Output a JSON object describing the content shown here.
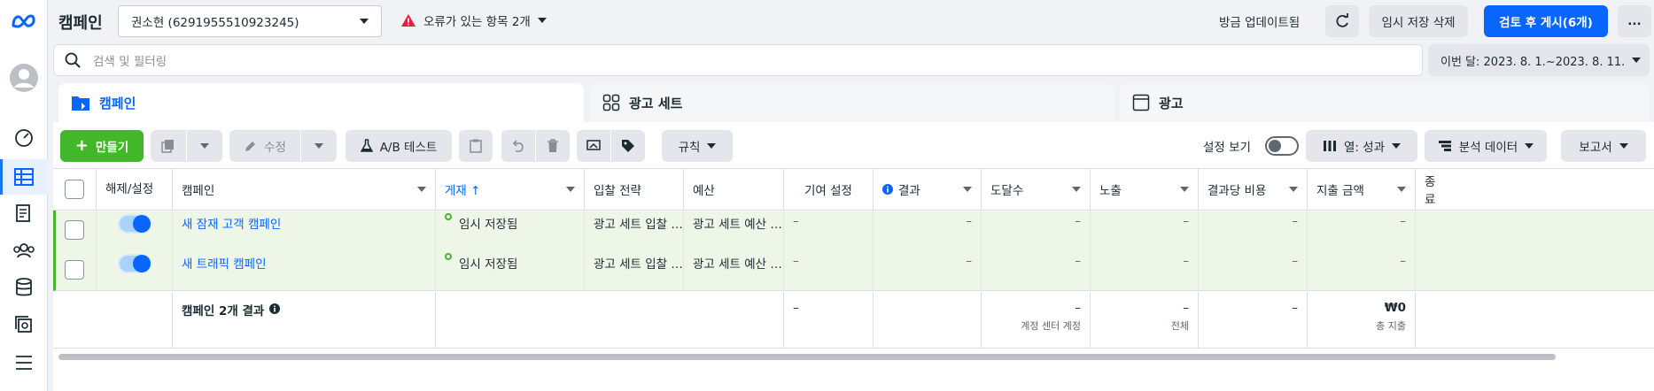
{
  "header": {
    "title": "캠페인",
    "account": "권소현 (6291955510923245)",
    "errors_label": "오류가 있는 항목 2개",
    "updated_label": "방금 업데이트됨",
    "discard_drafts": "임시 저장 삭제",
    "review_publish": "검토 후 게시(6개)",
    "more": "..."
  },
  "search": {
    "placeholder": "검색 및 필터링"
  },
  "date_range": "이번 달: 2023. 8. 1.~2023. 8. 11.",
  "tabs": [
    {
      "label": "캠페인",
      "active": true
    },
    {
      "label": "광고 세트",
      "active": false
    },
    {
      "label": "광고",
      "active": false
    }
  ],
  "toolbar": {
    "create": "만들기",
    "edit": "수정",
    "ab_test": "A/B 테스트",
    "rules": "규칙",
    "view_settings": "설정 보기",
    "columns": "열: 성과",
    "breakdown": "분석 데이터",
    "reports": "보고서"
  },
  "columns": {
    "toggle": "해제/설정",
    "campaign": "캠페인",
    "delivery": "게재 ↑",
    "bid_strategy": "입찰 전략",
    "budget": "예산",
    "attribution": "기여 설정",
    "results": "결과",
    "reach": "도달수",
    "impressions": "노출",
    "cost_per_result": "결과당 비용",
    "amount_spent": "지출 금액",
    "ends": "종료"
  },
  "rows": [
    {
      "campaign": "새 잠재 고객 캠페인",
      "delivery": "임시 저장됨",
      "bid_strategy": "광고 세트 입찰 …",
      "budget": "광고 세트 예산 …",
      "attribution": "–",
      "results": "–",
      "reach": "–",
      "impressions": "–",
      "cost_per_result": "–",
      "amount_spent": "–"
    },
    {
      "campaign": "새 트래픽 캠페인",
      "delivery": "임시 저장됨",
      "bid_strategy": "광고 세트 입찰 …",
      "budget": "광고 세트 예산 …",
      "attribution": "–",
      "results": "–",
      "reach": "–",
      "impressions": "–",
      "cost_per_result": "–",
      "amount_spent": "–"
    }
  ],
  "summary": {
    "label": "캠페인 2개 결과",
    "attribution": "–",
    "reach": "–",
    "reach_sub": "계정 센터 계정",
    "impressions": "–",
    "impressions_sub": "전체",
    "cost_per_result": "–",
    "amount_spent": "₩0",
    "amount_spent_sub": "총 지출"
  },
  "colors": {
    "brand": "#0866ff",
    "create": "#42b72a",
    "selected_row": "#eef6e8",
    "error": "#e41e3f"
  },
  "icons": [
    "meta-logo-icon",
    "avatar-icon",
    "dashboard-icon",
    "campaigns-table-icon",
    "pages-icon",
    "audiences-icon",
    "billing-icon",
    "catalog-icon",
    "menu-icon",
    "search-icon",
    "refresh-icon",
    "warning-icon",
    "folder-icon",
    "adsets-icon",
    "ad-icon"
  ]
}
